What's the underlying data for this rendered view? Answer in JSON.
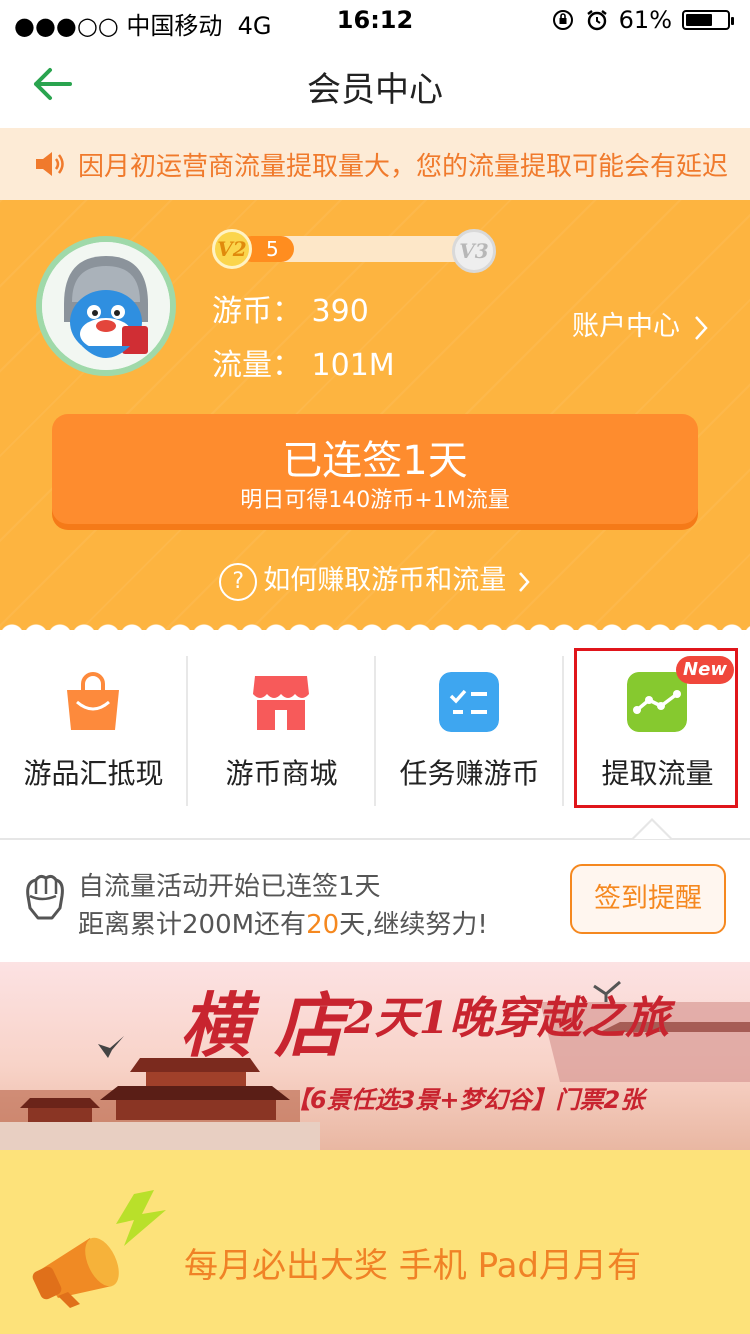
{
  "status_bar": {
    "carrier": "●●●○○ 中国移动",
    "network": "4G",
    "time": "16:12",
    "battery": "61%"
  },
  "nav": {
    "title": "会员中心",
    "back_icon": "back-arrow-icon"
  },
  "notice": {
    "text": "因月初运营商流量提取量大，您的流量提取可能会有延迟",
    "color": "#f07a2c"
  },
  "profile": {
    "level_current": "V2",
    "level_next": "V3",
    "level_progress_label": "5",
    "coins_label": "游币：",
    "coins_value": "390",
    "traffic_label": "流量：",
    "traffic_value": "101M",
    "account_link": "账户中心"
  },
  "signin": {
    "title": "已连签1天",
    "subtitle": "明日可得140游币+1M流量"
  },
  "howto": {
    "icon": "?",
    "text": "如何赚取游币和流量"
  },
  "features": [
    {
      "label": "游品汇抵现",
      "icon": "shopping-bag-icon",
      "color": "#fd8a3c"
    },
    {
      "label": "游币商城",
      "icon": "store-icon",
      "color": "#f75a5a"
    },
    {
      "label": "任务赚游币",
      "icon": "task-list-icon",
      "color": "#3ea6f0"
    },
    {
      "label": "提取流量",
      "icon": "traffic-chart-icon",
      "color": "#86c92f",
      "badge": "New"
    }
  ],
  "checkin": {
    "line1": "自流量活动开始已连签1天",
    "line2_prefix": "距离累计200M还有",
    "line2_highlight": "20",
    "line2_suffix": "天,继续努力!",
    "button": "签到提醒"
  },
  "banner": {
    "title_big": "横 店",
    "title_rest": "2天1晚穿越之旅",
    "subtitle": "【6景任选3景+梦幻谷】门票2张"
  },
  "promo": {
    "text": "每月必出大奖 手机 Pad月月有"
  },
  "colors": {
    "accent": "#fdb440",
    "button": "#fe8c2e",
    "highlight_box": "#e0151b"
  }
}
